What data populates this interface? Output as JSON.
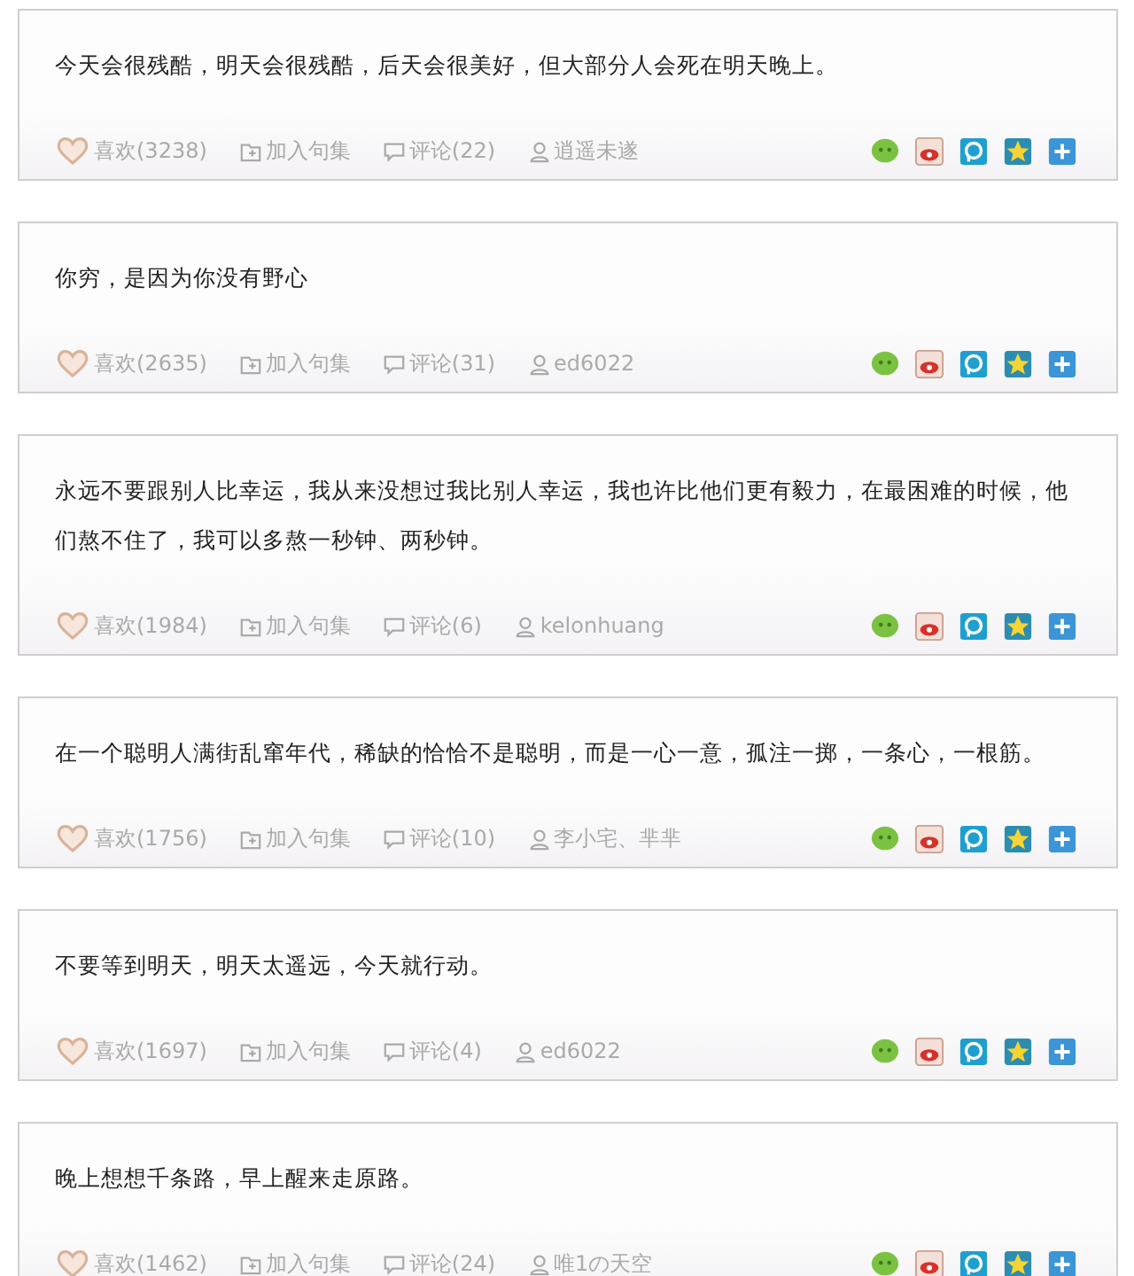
{
  "quotes": [
    {
      "text": "今天会很残酷，明天会很残酷，后天会很美好，但大部分人会死在明天晚上。",
      "like": "喜欢(3238)",
      "collect": "加入句集",
      "comment": "评论(22)",
      "author": "逍遥未遂"
    },
    {
      "text": "你穷，是因为你没有野心",
      "like": "喜欢(2635)",
      "collect": "加入句集",
      "comment": "评论(31)",
      "author": "ed6022"
    },
    {
      "text": "永远不要跟别人比幸运，我从来没想过我比别人幸运，我也许比他们更有毅力，在最困难的时候，他们熬不住了，我可以多熬一秒钟、两秒钟。",
      "like": "喜欢(1984)",
      "collect": "加入句集",
      "comment": "评论(6)",
      "author": "kelonhuang"
    },
    {
      "text": "在一个聪明人满街乱窜年代，稀缺的恰恰不是聪明，而是一心一意，孤注一掷，一条心，一根筋。",
      "like": "喜欢(1756)",
      "collect": "加入句集",
      "comment": "评论(10)",
      "author": "李小宅、芈芈"
    },
    {
      "text": "不要等到明天，明天太遥远，今天就行动。",
      "like": "喜欢(1697)",
      "collect": "加入句集",
      "comment": "评论(4)",
      "author": "ed6022"
    },
    {
      "text": "晚上想想千条路，早上醒来走原路。",
      "like": "喜欢(1462)",
      "collect": "加入句集",
      "comment": "评论(24)",
      "author": "唯1の天空"
    }
  ]
}
